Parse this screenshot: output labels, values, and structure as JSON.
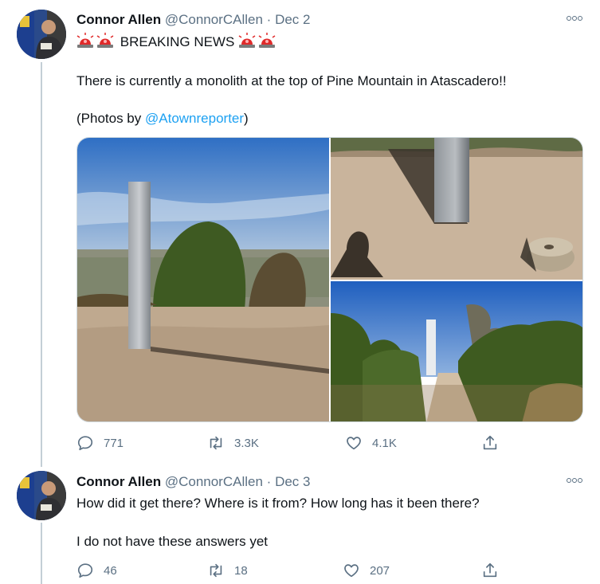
{
  "tweets": [
    {
      "author_name": "Connor Allen",
      "author_handle": "@ConnorCAllen",
      "separator": "·",
      "date": "Dec 2",
      "headline": "BREAKING NEWS",
      "body": "There is currently a monolith at the top of Pine Mountain in Atascadero!!",
      "credit_prefix": "(Photos by ",
      "credit_link": "@Atownreporter",
      "credit_suffix": ")",
      "replies": "771",
      "retweets": "3.3K",
      "likes": "4.1K"
    },
    {
      "author_name": "Connor Allen",
      "author_handle": "@ConnorCAllen",
      "separator": "·",
      "date": "Dec 3",
      "body_line1": "How did it get there? Where is it from? How long has it been there?",
      "body_line2": "I do not have these answers yet",
      "replies": "46",
      "retweets": "18",
      "likes": "207"
    }
  ],
  "icons": {
    "reply": "reply-icon",
    "retweet": "retweet-icon",
    "like": "heart-icon",
    "share": "share-icon",
    "more": "more-options-icon",
    "siren": "police-light-emoji"
  },
  "colors": {
    "link": "#1da1f2",
    "secondary_text": "#5b7083",
    "thread_line": "#c4cfd6"
  }
}
